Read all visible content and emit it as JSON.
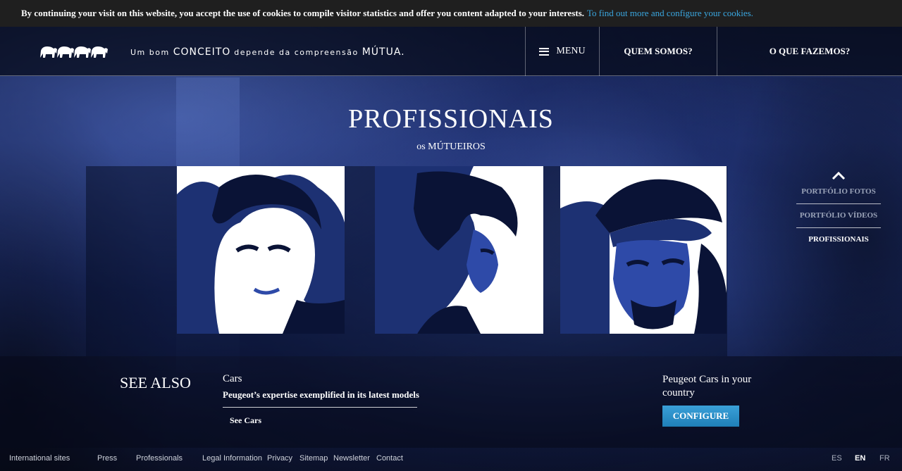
{
  "cookie": {
    "text": "By continuing your visit on this website, you accept the use of cookies to compile visitor statistics and offer you content adapted to your interests.",
    "link": "To find out more and configure your cookies."
  },
  "header": {
    "tagline_parts": [
      "Um bom",
      "CONCEITO",
      "depende da compreensão",
      "MÚTUA."
    ],
    "menu_label": "MENU",
    "nav": [
      "QUEM SOMOS?",
      "O QUE FAZEMOS?"
    ]
  },
  "page": {
    "title": "PROFISSIONAIS",
    "subtitle": "os MÚTUEIROS"
  },
  "side_nav": {
    "items": [
      "PORTFÓLIO FOTOS",
      "PORTFÓLIO VÍDEOS",
      "PROFISSIONAIS"
    ],
    "active": "PROFISSIONAIS"
  },
  "see_also": {
    "title": "SEE ALSO",
    "cars_title": "Cars",
    "cars_desc": "Peugeot’s expertise exemplified in its latest models",
    "cars_link": "See Cars",
    "country_title": "Peugeot Cars in your country",
    "configure_label": "CONFIGURE"
  },
  "footer": {
    "links": [
      "International sites",
      "Press",
      "Professionals",
      "Legal Information",
      "Privacy",
      "Sitemap",
      "Newsletter",
      "Contact"
    ],
    "languages": [
      "ES",
      "EN",
      "FR"
    ],
    "active_language": "EN"
  },
  "colors": {
    "cookie_link": "#3aa7e0",
    "configure_button": "#2a8fc8",
    "background": "#162457"
  },
  "icons": [
    "elephants-logo-icon",
    "hamburger-icon",
    "chevron-up-icon"
  ]
}
